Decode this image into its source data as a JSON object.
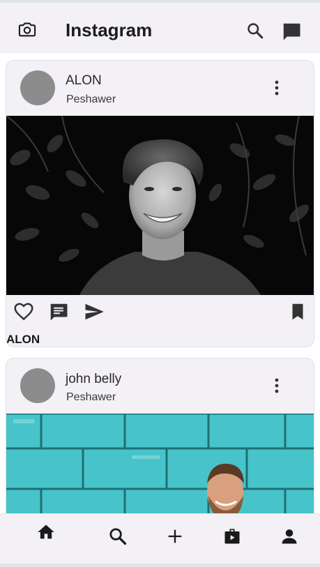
{
  "app": {
    "title": "Instagram"
  },
  "posts": [
    {
      "username": "ALON",
      "location": "Peshawer",
      "caption_user": "ALON"
    },
    {
      "username": "john belly",
      "location": "Peshawer"
    }
  ],
  "icons": {
    "camera": "camera-icon",
    "search": "search-icon",
    "messages": "chat-icon",
    "more": "more-vert-icon",
    "like": "heart-icon",
    "comment": "comment-icon",
    "share": "send-icon",
    "save": "bookmark-icon"
  },
  "nav": [
    "home-icon",
    "search-icon",
    "add-icon",
    "reels-icon",
    "profile-icon"
  ],
  "colors": {
    "bar": "#f3f0f6",
    "icon": "#333333",
    "avatar": "#8c8c8c",
    "teal_wall": "#46c4c9"
  }
}
